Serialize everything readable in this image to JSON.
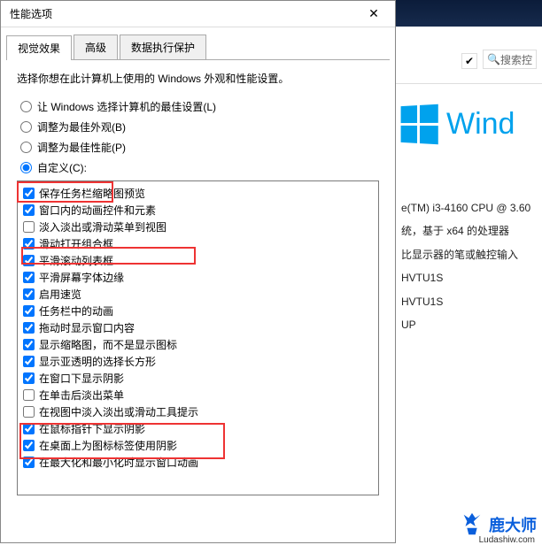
{
  "dialog": {
    "title": "性能选项",
    "close": "✕",
    "tabs": [
      {
        "label": "视觉效果",
        "active": true
      },
      {
        "label": "高级",
        "active": false
      },
      {
        "label": "数据执行保护",
        "active": false
      }
    ],
    "description": "选择你想在此计算机上使用的 Windows 外观和性能设置。",
    "radios": [
      {
        "label": "让 Windows 选择计算机的最佳设置(L)",
        "checked": false
      },
      {
        "label": "调整为最佳外观(B)",
        "checked": false
      },
      {
        "label": "调整为最佳性能(P)",
        "checked": false
      },
      {
        "label": "自定义(C):",
        "checked": true
      }
    ],
    "checks": [
      {
        "label": "保存任务栏缩略图预览",
        "checked": true
      },
      {
        "label": "窗口内的动画控件和元素",
        "checked": true
      },
      {
        "label": "淡入淡出或滑动菜单到视图",
        "checked": false
      },
      {
        "label": "滑动打开组合框",
        "checked": true
      },
      {
        "label": "平滑滚动列表框",
        "checked": true
      },
      {
        "label": "平滑屏幕字体边缘",
        "checked": true
      },
      {
        "label": "启用速览",
        "checked": true
      },
      {
        "label": "任务栏中的动画",
        "checked": true
      },
      {
        "label": "拖动时显示窗口内容",
        "checked": true
      },
      {
        "label": "显示缩略图，而不是显示图标",
        "checked": true
      },
      {
        "label": "显示亚透明的选择长方形",
        "checked": true
      },
      {
        "label": "在窗口下显示阴影",
        "checked": true
      },
      {
        "label": "在单击后淡出菜单",
        "checked": false
      },
      {
        "label": "在视图中淡入淡出或滑动工具提示",
        "checked": false
      },
      {
        "label": "在鼠标指针下显示阴影",
        "checked": true
      },
      {
        "label": "在桌面上为图标标签使用阴影",
        "checked": true
      },
      {
        "label": "在最大化和最小化时显示窗口动画",
        "checked": true
      }
    ]
  },
  "background": {
    "search_placeholder": "搜索控",
    "win_text": "Wind",
    "sys_info": [
      "e(TM) i3-4160 CPU @ 3.60",
      "统，基于 x64 的处理器",
      "比显示器的笔或触控输入",
      "HVTU1S",
      "HVTU1S",
      "UP"
    ]
  },
  "watermark": {
    "text": "鹿大师",
    "url": "Ludashiw.com"
  }
}
